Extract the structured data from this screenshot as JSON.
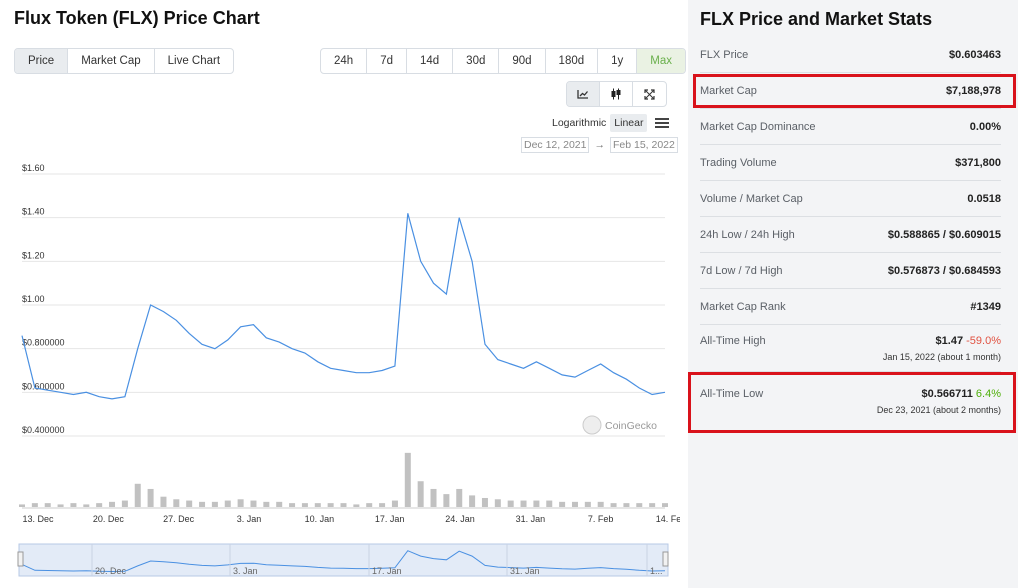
{
  "page_title": "Flux Token (FLX) Price Chart",
  "chart_tabs": [
    "Price",
    "Market Cap",
    "Live Chart"
  ],
  "range_tabs": [
    "24h",
    "7d",
    "14d",
    "30d",
    "90d",
    "180d",
    "1y",
    "Max"
  ],
  "view_icons": [
    "line-chart-icon",
    "candlestick-icon",
    "fullscreen-icon"
  ],
  "scale": {
    "logarithmic": "Logarithmic",
    "linear": "Linear"
  },
  "date_range": {
    "from": "Dec 12, 2021",
    "arrow": "→",
    "to": "Feb 15, 2022"
  },
  "watermark": "CoinGecko",
  "colors": {
    "line": "#4a90e2",
    "fill": "#e3ebf7",
    "volume": "#a6a6a6",
    "highlight": "#d9121b"
  },
  "chart_data": {
    "type": "line",
    "title": "",
    "y_tick_labels": [
      "$1.60",
      "$1.40",
      "$1.20",
      "$1.00",
      "$0.800000",
      "$0.600000",
      "$0.400000"
    ],
    "y_ticks": [
      1.6,
      1.4,
      1.2,
      1.0,
      0.8,
      0.6,
      0.4
    ],
    "ylim": [
      0.4,
      1.6
    ],
    "x_tick_labels": [
      "13. Dec",
      "20. Dec",
      "27. Dec",
      "3. Jan",
      "10. Jan",
      "17. Jan",
      "24. Jan",
      "31. Jan",
      "7. Feb",
      "14. Feb"
    ],
    "navigator_labels": [
      "20. Dec",
      "3. Jan",
      "17. Jan",
      "31. Jan",
      "1..."
    ],
    "series": [
      {
        "x": [
          "Dec 12",
          "Dec 13",
          "Dec 14",
          "Dec 16",
          "Dec 18",
          "Dec 20",
          "Dec 22",
          "Dec 23",
          "Dec 24",
          "Dec 25",
          "Dec 26",
          "Dec 27",
          "Dec 28",
          "Dec 29",
          "Dec 30",
          "Dec 31",
          "Jan 1",
          "Jan 2",
          "Jan 3",
          "Jan 4",
          "Jan 5",
          "Jan 6",
          "Jan 7",
          "Jan 8",
          "Jan 9",
          "Jan 10",
          "Jan 11",
          "Jan 12",
          "Jan 13",
          "Jan 14",
          "Jan 15",
          "Jan 16",
          "Jan 17",
          "Jan 18",
          "Jan 19",
          "Jan 20",
          "Jan 21",
          "Jan 22",
          "Jan 23",
          "Jan 24",
          "Jan 26",
          "Jan 28",
          "Jan 30",
          "Feb 1",
          "Feb 3",
          "Feb 5",
          "Feb 7",
          "Feb 9",
          "Feb 11",
          "Feb 13",
          "Feb 15"
        ],
        "values": [
          0.86,
          0.62,
          0.61,
          0.6,
          0.59,
          0.6,
          0.58,
          0.57,
          0.58,
          0.8,
          1.0,
          0.97,
          0.93,
          0.87,
          0.82,
          0.8,
          0.84,
          0.9,
          0.91,
          0.85,
          0.83,
          0.8,
          0.78,
          0.74,
          0.71,
          0.7,
          0.69,
          0.69,
          0.7,
          0.72,
          1.42,
          1.2,
          1.1,
          1.05,
          1.4,
          1.2,
          0.82,
          0.75,
          0.73,
          0.71,
          0.74,
          0.71,
          0.68,
          0.67,
          0.7,
          0.73,
          0.69,
          0.66,
          0.62,
          0.59,
          0.6
        ]
      }
    ],
    "volume": [
      2,
      3,
      3,
      2,
      3,
      2,
      3,
      4,
      5,
      18,
      14,
      8,
      6,
      5,
      4,
      4,
      5,
      6,
      5,
      4,
      4,
      3,
      3,
      3,
      3,
      3,
      2,
      3,
      3,
      5,
      42,
      20,
      14,
      10,
      14,
      9,
      7,
      6,
      5,
      5,
      5,
      5,
      4,
      4,
      4,
      4,
      3,
      3,
      3,
      3,
      3
    ]
  },
  "stats": {
    "title": "FLX Price and Market Stats",
    "rows": [
      {
        "label": "FLX Price",
        "value": "$0.603463"
      },
      {
        "label": "Market Cap",
        "value": "$7,188,978"
      },
      {
        "label": "Market Cap Dominance",
        "value": "0.00%"
      },
      {
        "label": "Trading Volume",
        "value": "$371,800"
      },
      {
        "label": "Volume / Market Cap",
        "value": "0.0518"
      },
      {
        "label": "24h Low / 24h High",
        "value": "$0.588865 / $0.609015"
      },
      {
        "label": "7d Low / 7d High",
        "value": "$0.576873 / $0.684593"
      },
      {
        "label": "Market Cap Rank",
        "value": "#1349"
      }
    ],
    "ath": {
      "label": "All-Time High",
      "value": "$1.47",
      "change": "-59.0%",
      "date": "Jan 15, 2022 (about 1 month)"
    },
    "atl": {
      "label": "All-Time Low",
      "value": "$0.566711",
      "change": "6.4%",
      "date": "Dec 23, 2021 (about 2 months)"
    }
  }
}
